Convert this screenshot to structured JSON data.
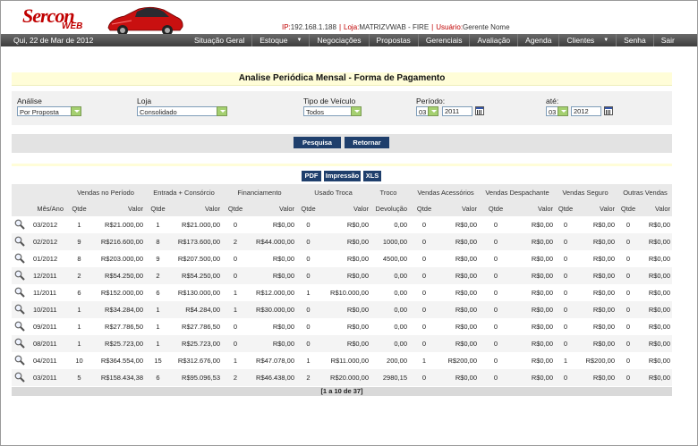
{
  "header": {
    "logo": "Sercon",
    "logo_sub": "WEB",
    "ip_label": "IP:",
    "ip_value": "192.168.1.188",
    "loja_label": "Loja:",
    "loja_value": "MATRIZVWAB - FIRE",
    "usuario_label": "Usuário:",
    "usuario_value": "Gerente Nome",
    "separator": "|"
  },
  "nav": {
    "date": "Qui, 22 de Mar de 2012",
    "items": [
      {
        "label": "Situação Geral"
      },
      {
        "label": "Estoque",
        "arrow": "▼"
      },
      {
        "label": "Negociações"
      },
      {
        "label": "Propostas"
      },
      {
        "label": "Gerenciais"
      },
      {
        "label": "Avaliação"
      },
      {
        "label": "Agenda"
      },
      {
        "label": "Clientes",
        "arrow": "▼"
      },
      {
        "label": "Senha"
      },
      {
        "label": "Sair"
      }
    ]
  },
  "title": "Analise Periódica Mensal - Forma de Pagamento",
  "filters": {
    "analise_label": "Análise",
    "analise_value": "Por Proposta",
    "loja_label": "Loja",
    "loja_value": "Consolidado",
    "tipo_label": "Tipo de Veículo",
    "tipo_value": "Todos",
    "periodo_label": "Período:",
    "periodo_mes": "03",
    "periodo_ano": "2011",
    "ate_label": "até:",
    "ate_mes": "03",
    "ate_ano": "2012"
  },
  "actions": {
    "pesquisa": "Pesquisa",
    "retornar": "Retornar",
    "pdf": "PDF",
    "impressao": "Impressão",
    "xls": "XLS"
  },
  "table": {
    "groups": [
      "Vendas no Período",
      "Entrada + Consórcio",
      "Financiamento",
      "Usado Troca",
      "Troco",
      "Vendas Acessórios",
      "Vendas Despachante",
      "Vendas Seguro",
      "Outras Vendas"
    ],
    "subheaders": {
      "mes": "Mês/Ano",
      "qtde": "Qtde",
      "valor": "Valor",
      "devolucao": "Devolução"
    },
    "rows": [
      [
        "03/2012",
        "1",
        "R$21.000,00",
        "1",
        "R$21.000,00",
        "0",
        "R$0,00",
        "0",
        "R$0,00",
        "0,00",
        "0",
        "R$0,00",
        "0",
        "R$0,00",
        "0",
        "R$0,00",
        "0",
        "R$0,00"
      ],
      [
        "02/2012",
        "9",
        "R$216.600,00",
        "8",
        "R$173.600,00",
        "2",
        "R$44.000,00",
        "0",
        "R$0,00",
        "1000,00",
        "0",
        "R$0,00",
        "0",
        "R$0,00",
        "0",
        "R$0,00",
        "0",
        "R$0,00"
      ],
      [
        "01/2012",
        "8",
        "R$203.000,00",
        "9",
        "R$207.500,00",
        "0",
        "R$0,00",
        "0",
        "R$0,00",
        "4500,00",
        "0",
        "R$0,00",
        "0",
        "R$0,00",
        "0",
        "R$0,00",
        "0",
        "R$0,00"
      ],
      [
        "12/2011",
        "2",
        "R$54.250,00",
        "2",
        "R$54.250,00",
        "0",
        "R$0,00",
        "0",
        "R$0,00",
        "0,00",
        "0",
        "R$0,00",
        "0",
        "R$0,00",
        "0",
        "R$0,00",
        "0",
        "R$0,00"
      ],
      [
        "11/2011",
        "6",
        "R$152.000,00",
        "6",
        "R$130.000,00",
        "1",
        "R$12.000,00",
        "1",
        "R$10.000,00",
        "0,00",
        "0",
        "R$0,00",
        "0",
        "R$0,00",
        "0",
        "R$0,00",
        "0",
        "R$0,00"
      ],
      [
        "10/2011",
        "1",
        "R$34.284,00",
        "1",
        "R$4.284,00",
        "1",
        "R$30.000,00",
        "0",
        "R$0,00",
        "0,00",
        "0",
        "R$0,00",
        "0",
        "R$0,00",
        "0",
        "R$0,00",
        "0",
        "R$0,00"
      ],
      [
        "09/2011",
        "1",
        "R$27.786,50",
        "1",
        "R$27.786,50",
        "0",
        "R$0,00",
        "0",
        "R$0,00",
        "0,00",
        "0",
        "R$0,00",
        "0",
        "R$0,00",
        "0",
        "R$0,00",
        "0",
        "R$0,00"
      ],
      [
        "08/2011",
        "1",
        "R$25.723,00",
        "1",
        "R$25.723,00",
        "0",
        "R$0,00",
        "0",
        "R$0,00",
        "0,00",
        "0",
        "R$0,00",
        "0",
        "R$0,00",
        "0",
        "R$0,00",
        "0",
        "R$0,00"
      ],
      [
        "04/2011",
        "10",
        "R$364.554,00",
        "15",
        "R$312.676,00",
        "1",
        "R$47.078,00",
        "1",
        "R$11.000,00",
        "200,00",
        "1",
        "R$200,00",
        "0",
        "R$0,00",
        "1",
        "R$200,00",
        "0",
        "R$0,00"
      ],
      [
        "03/2011",
        "5",
        "R$158.434,38",
        "6",
        "R$95.096,53",
        "2",
        "R$46.438,00",
        "2",
        "R$20.000,00",
        "2980,15",
        "0",
        "R$0,00",
        "0",
        "R$0,00",
        "0",
        "R$0,00",
        "0",
        "R$0,00"
      ]
    ]
  },
  "pager": "[1 a 10 de 37]"
}
